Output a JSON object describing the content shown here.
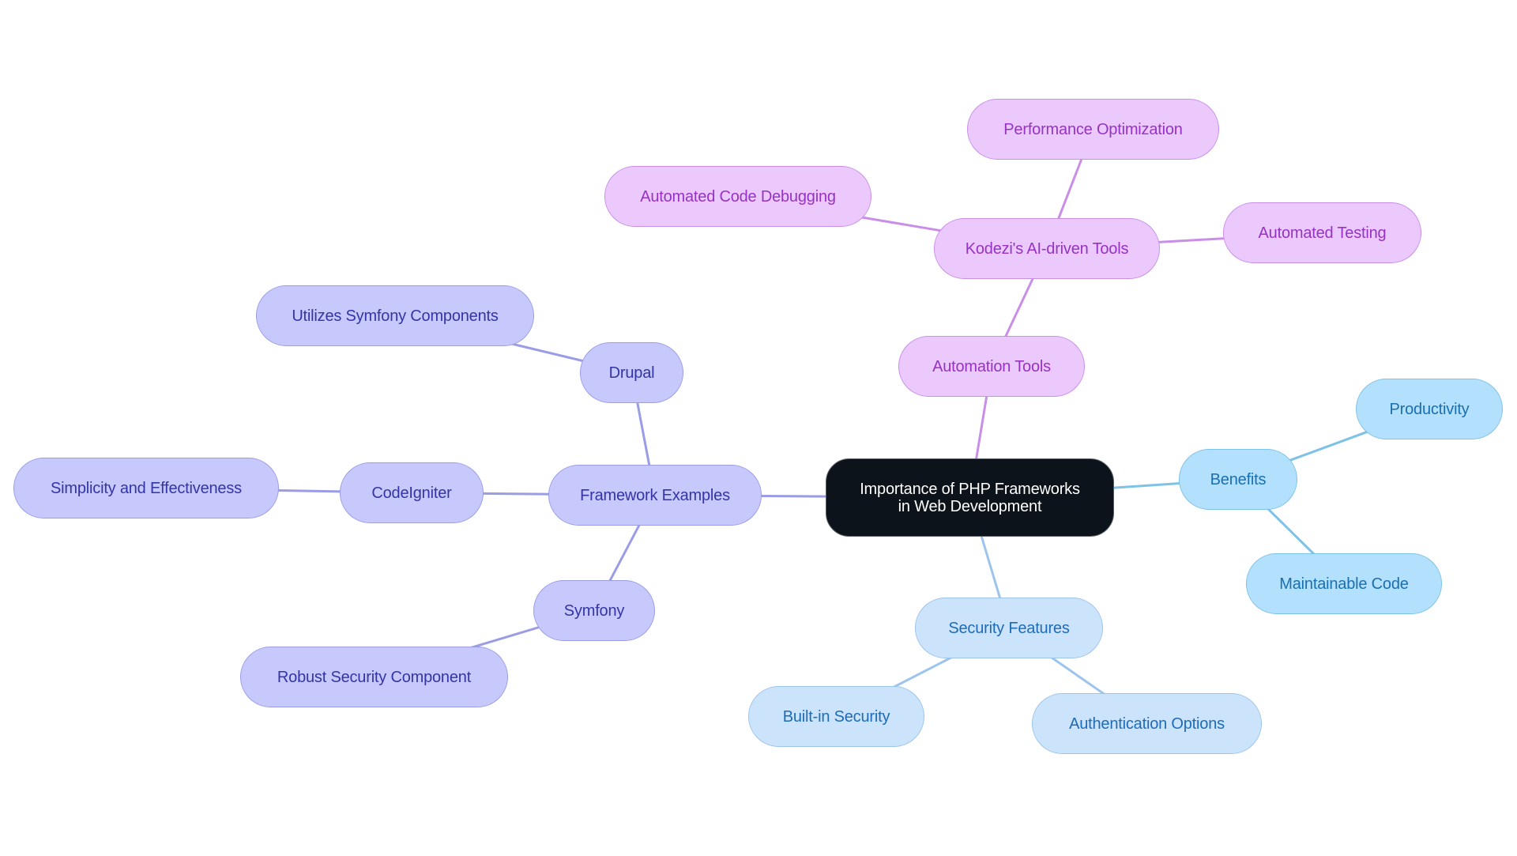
{
  "diagram": {
    "type": "mindmap",
    "root": {
      "id": "root",
      "label_line1": "Importance of PHP Frameworks",
      "label_line2": "in Web Development"
    },
    "colors": {
      "root_fill": "#0c131a",
      "root_text": "#ffffff",
      "indigo_fill": "#c7c9fc",
      "indigo_stroke": "#9a9de6",
      "indigo_text": "#3434a6",
      "purple_fill": "#ebc9fd",
      "purple_stroke": "#c98ee8",
      "purple_text": "#9632c4",
      "sky_fill": "#b3e0fc",
      "sky_stroke": "#7ec2e8",
      "sky_text": "#1a6fb0",
      "lightblue_fill": "#cce4fb",
      "lightblue_stroke": "#9cc4ec",
      "lightblue_text": "#1e6bb8"
    },
    "nodes": {
      "framework_examples": {
        "label": "Framework Examples",
        "parent": "root",
        "branch": "indigo"
      },
      "drupal": {
        "label": "Drupal",
        "parent": "framework_examples",
        "branch": "indigo"
      },
      "utilizes_symfony": {
        "label": "Utilizes Symfony Components",
        "parent": "drupal",
        "branch": "indigo"
      },
      "codeigniter": {
        "label": "CodeIgniter",
        "parent": "framework_examples",
        "branch": "indigo"
      },
      "simplicity": {
        "label": "Simplicity and Effectiveness",
        "parent": "codeigniter",
        "branch": "indigo"
      },
      "symfony": {
        "label": "Symfony",
        "parent": "framework_examples",
        "branch": "indigo"
      },
      "robust_security": {
        "label": "Robust Security Component",
        "parent": "symfony",
        "branch": "indigo"
      },
      "automation_tools": {
        "label": "Automation Tools",
        "parent": "root",
        "branch": "purple"
      },
      "kodezi_tools": {
        "label": "Kodezi's AI-driven Tools",
        "parent": "automation_tools",
        "branch": "purple"
      },
      "performance_optimization": {
        "label": "Performance Optimization",
        "parent": "kodezi_tools",
        "branch": "purple"
      },
      "automated_code_debugging": {
        "label": "Automated Code Debugging",
        "parent": "kodezi_tools",
        "branch": "purple"
      },
      "automated_testing": {
        "label": "Automated Testing",
        "parent": "kodezi_tools",
        "branch": "purple"
      },
      "benefits": {
        "label": "Benefits",
        "parent": "root",
        "branch": "sky"
      },
      "productivity": {
        "label": "Productivity",
        "parent": "benefits",
        "branch": "sky"
      },
      "maintainable_code": {
        "label": "Maintainable Code",
        "parent": "benefits",
        "branch": "sky"
      },
      "security_features": {
        "label": "Security Features",
        "parent": "root",
        "branch": "lightblue"
      },
      "builtin_security": {
        "label": "Built-in Security",
        "parent": "security_features",
        "branch": "lightblue"
      },
      "authentication_options": {
        "label": "Authentication Options",
        "parent": "security_features",
        "branch": "lightblue"
      }
    }
  }
}
